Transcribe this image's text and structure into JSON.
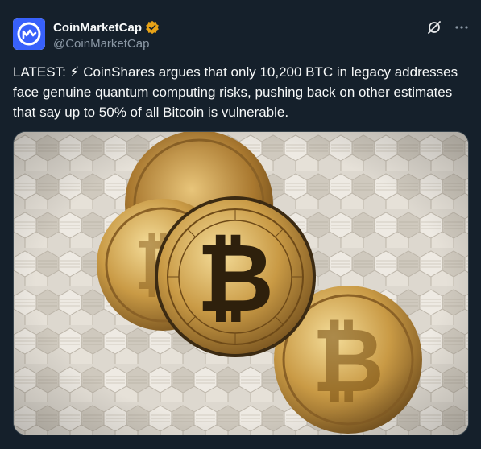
{
  "author": {
    "display_name": "CoinMarketCap",
    "handle": "@CoinMarketCap",
    "verified_badge_color": "#e8a317",
    "avatar_icon": "coinmarketcap-logo-icon",
    "avatar_color": "#3861fb"
  },
  "actions": {
    "grok_icon": "grok-icon",
    "more_icon": "more-options-icon"
  },
  "post": {
    "text": "LATEST: ⚡ CoinShares argues that only 10,200 BTC in legacy addresses face genuine quantum computing risks, pushing back on other estimates that say up to 50% of all Bitcoin is vulnerable."
  },
  "media": {
    "description_icon": "bitcoin-coins-photo",
    "coin_symbol": "₿"
  },
  "colors": {
    "background": "#15202b",
    "text": "#f7f9f9",
    "secondary_text": "#8b98a5",
    "gold": "#c9a04a"
  }
}
